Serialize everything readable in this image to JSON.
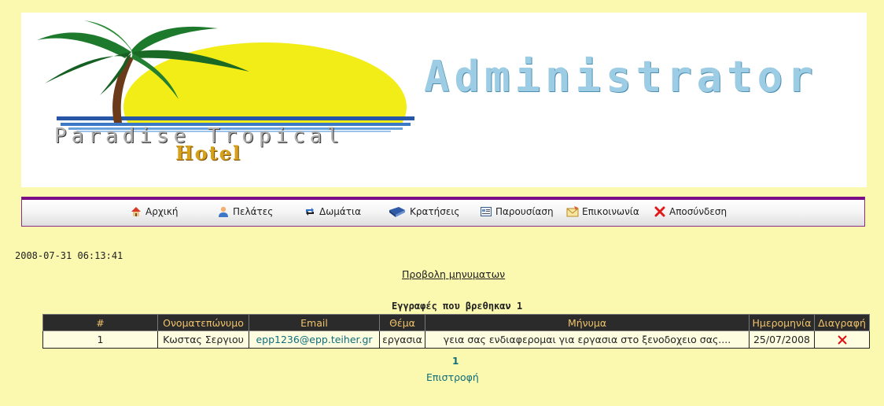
{
  "header": {
    "admin_title": "Administrator",
    "logo_line1": "Paradise Tropical",
    "logo_line2": "Hotel"
  },
  "nav": {
    "items": [
      {
        "label": "Αρχική",
        "icon": "home-icon"
      },
      {
        "label": "Πελάτες",
        "icon": "user-icon"
      },
      {
        "label": "Δωμάτια",
        "icon": "refresh-arrows-icon"
      },
      {
        "label": "Κρατήσεις",
        "icon": "book-icon"
      },
      {
        "label": "Παρουσίαση",
        "icon": "presentation-icon"
      },
      {
        "label": "Επικοινωνία",
        "icon": "mail-icon"
      },
      {
        "label": "Αποσύνδεση",
        "icon": "close-x-icon"
      }
    ]
  },
  "timestamp": "2008-07-31 06:13:41",
  "view_messages_link": "Προβολη μηνυματων",
  "records_found": "Εγγραφές που βρεθηκαν 1",
  "table": {
    "headers": [
      "#",
      "Ονοματεπώνυμο",
      "Email",
      "Θέμα",
      "Μήνυμα",
      "Ημερομηνία",
      "Διαγραφή"
    ],
    "rows": [
      {
        "id": "1",
        "name": "Κωστας Σεργιου",
        "email": "epp1236@epp.teiher.gr",
        "subject": "εργασια",
        "message": "γεια σας ενδιαφερομαι για εργασια στο ξενοδοχειο σας....",
        "date": "25/07/2008"
      }
    ]
  },
  "pagination": "1",
  "back_link": "Επιστροφή",
  "colors": {
    "page_background": "#fbf8b0",
    "table_header_bg": "#2b2b2b",
    "table_header_text": "#f0c36b",
    "nav_top_border": "#7a0e86",
    "link_color": "#0e6e7a",
    "delete_red": "#e01010"
  }
}
